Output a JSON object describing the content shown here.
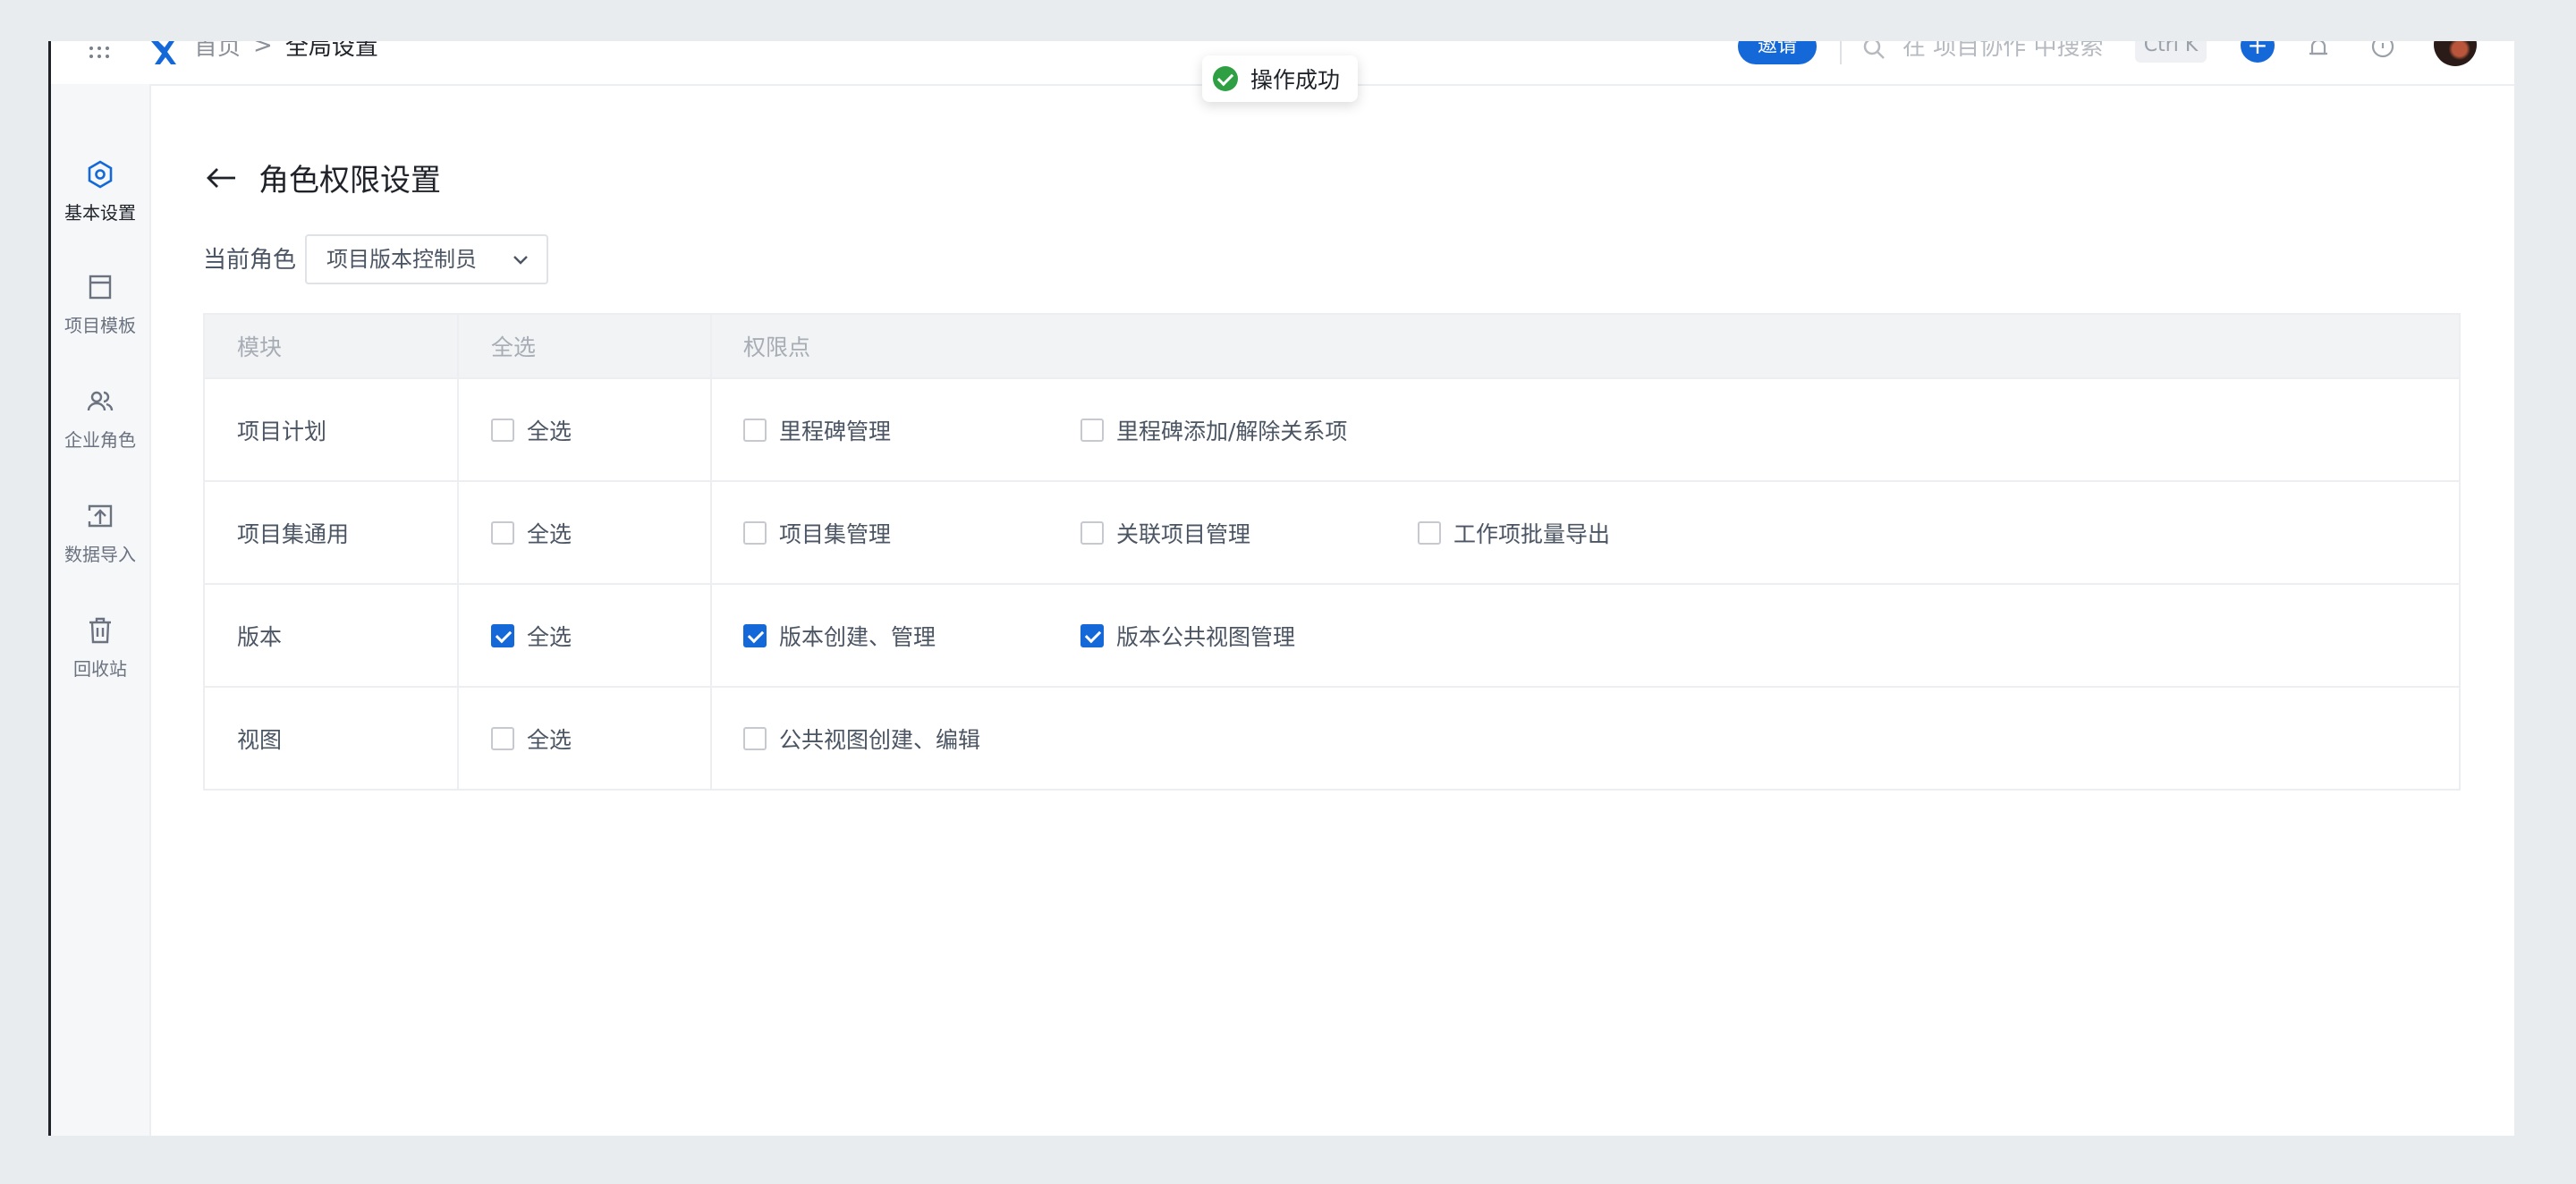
{
  "header": {
    "breadcrumb": [
      "首页",
      "全局设置"
    ],
    "breadcrumb_sep": ">",
    "invite_label": "邀请",
    "search_placeholder": "在 项目协作 中搜索",
    "shortcut": "Ctrl K",
    "add_label": "+"
  },
  "toast": {
    "message": "操作成功"
  },
  "sidebar": {
    "items": [
      {
        "label": "基本设置",
        "icon": "settings-icon",
        "active": true
      },
      {
        "label": "项目模板",
        "icon": "template-icon"
      },
      {
        "label": "企业角色",
        "icon": "users-icon"
      },
      {
        "label": "数据导入",
        "icon": "import-icon"
      },
      {
        "label": "回收站",
        "icon": "trash-icon"
      }
    ]
  },
  "page": {
    "title": "角色权限设置",
    "role_label": "当前角色",
    "role_value": "项目版本控制员"
  },
  "table": {
    "headers": [
      "模块",
      "全选",
      "权限点"
    ],
    "rows": [
      {
        "module": "项目计划",
        "select_all": {
          "label": "全选",
          "checked": false
        },
        "perms": [
          {
            "label": "里程碑管理",
            "checked": false
          },
          {
            "label": "里程碑添加/解除关系项",
            "checked": false
          }
        ]
      },
      {
        "module": "项目集通用",
        "select_all": {
          "label": "全选",
          "checked": false
        },
        "perms": [
          {
            "label": "项目集管理",
            "checked": false
          },
          {
            "label": "关联项目管理",
            "checked": false
          },
          {
            "label": "工作项批量导出",
            "checked": false
          }
        ]
      },
      {
        "module": "版本",
        "select_all": {
          "label": "全选",
          "checked": true
        },
        "perms": [
          {
            "label": "版本创建、管理",
            "checked": true
          },
          {
            "label": "版本公共视图管理",
            "checked": true
          }
        ]
      },
      {
        "module": "视图",
        "select_all": {
          "label": "全选",
          "checked": false
        },
        "perms": [
          {
            "label": "公共视图创建、编辑",
            "checked": false
          }
        ]
      }
    ]
  },
  "colors": {
    "accent": "#1468d8",
    "success": "#2ea043",
    "border": "#eceef1"
  }
}
